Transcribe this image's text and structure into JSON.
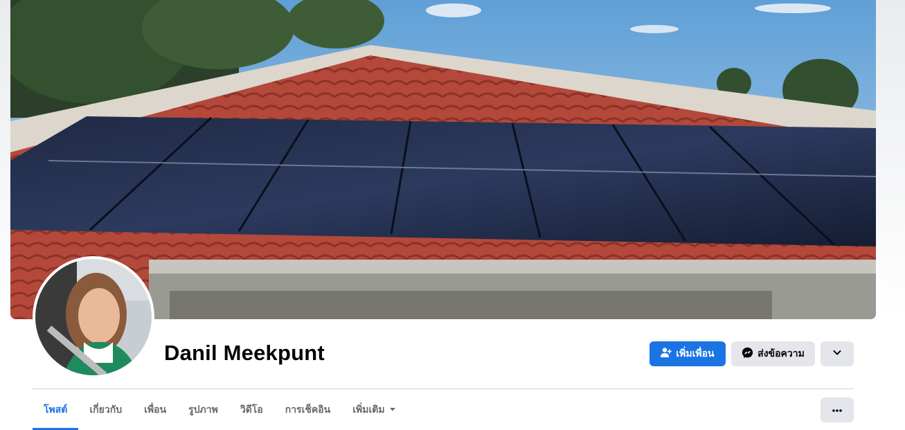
{
  "profile": {
    "name": "Danil Meekpunt"
  },
  "actions": {
    "add_friend": "เพิ่มเพื่อน",
    "message": "ส่งข้อความ"
  },
  "tabs": [
    {
      "label": "โพสต์",
      "active": true
    },
    {
      "label": "เกี่ยวกับ",
      "active": false
    },
    {
      "label": "เพื่อน",
      "active": false
    },
    {
      "label": "รูปภาพ",
      "active": false
    },
    {
      "label": "วิดีโอ",
      "active": false
    },
    {
      "label": "การเช็คอิน",
      "active": false
    },
    {
      "label": "เพิ่มเติม",
      "active": false
    }
  ],
  "icons": {
    "add_friend": "person-plus-icon",
    "message": "messenger-icon",
    "dropdown": "chevron-down-icon",
    "more": "more-dots-icon",
    "tab_more": "caret-down-icon"
  },
  "colors": {
    "accent": "#1b74e4",
    "secondary_button": "#e4e6eb",
    "text_primary": "#050505",
    "text_secondary": "#65676b"
  }
}
